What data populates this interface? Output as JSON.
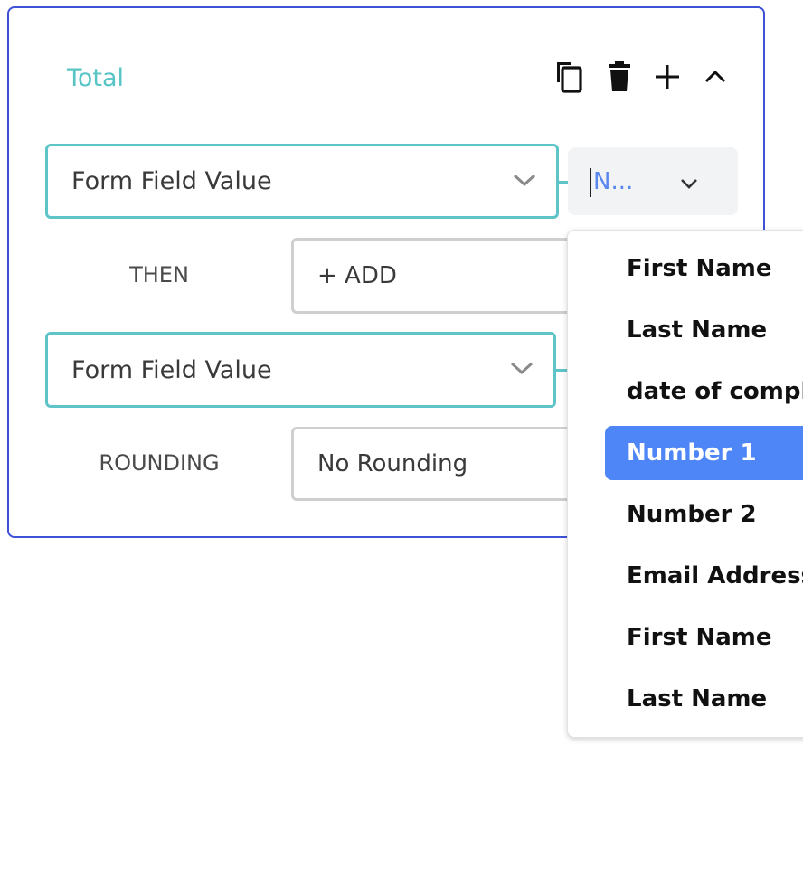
{
  "card": {
    "title": "Total",
    "toolbar": {
      "copy_icon": "copy-icon",
      "delete_icon": "trash-icon",
      "add_icon": "plus-icon",
      "collapse_icon": "chevron-up-icon"
    }
  },
  "rows": {
    "first_select": {
      "value": "Form Field Value"
    },
    "then_label": "THEN",
    "then_field": {
      "value": "+ ADD"
    },
    "second_select": {
      "value": "Form Field Value"
    },
    "rounding_label": "ROUNDING",
    "rounding_field": {
      "value": "No Rounding"
    }
  },
  "field_picker": {
    "value": "N...",
    "open": true
  },
  "dropdown": {
    "items": [
      {
        "label": "First Name",
        "selected": false
      },
      {
        "label": "Last Name",
        "selected": false
      },
      {
        "label": "date of compl",
        "selected": false
      },
      {
        "label": "Number 1",
        "selected": true
      },
      {
        "label": "Number 2",
        "selected": false
      },
      {
        "label": "Email Address",
        "selected": false
      },
      {
        "label": "First Name",
        "selected": false
      },
      {
        "label": "Last Name",
        "selected": false
      }
    ]
  },
  "colors": {
    "card_border": "#3f51d4",
    "accent_teal": "#5ec4c8",
    "title_teal": "#58c4c6",
    "selected_item_bg": "#4f86f7",
    "picker_value": "#5a86f0"
  }
}
